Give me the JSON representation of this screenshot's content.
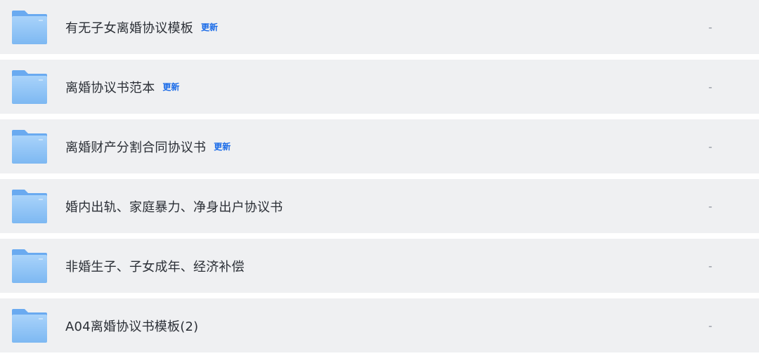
{
  "files": [
    {
      "name": "有无子女离婚协议模板",
      "badge": "更新",
      "meta": "-"
    },
    {
      "name": "离婚协议书范本",
      "badge": "更新",
      "meta": "-"
    },
    {
      "name": "离婚财产分割合同协议书",
      "badge": "更新",
      "meta": "-"
    },
    {
      "name": "婚内出轨、家庭暴力、净身出户协议书",
      "badge": "",
      "meta": "-"
    },
    {
      "name": "非婚生子、子女成年、经济补偿",
      "badge": "",
      "meta": "-"
    },
    {
      "name": "A04离婚协议书模板(2)",
      "badge": "",
      "meta": "-"
    }
  ],
  "icons": {
    "folder": "folder-icon"
  },
  "colors": {
    "row_bg": "#eff0f2",
    "badge": "#1a6be8",
    "folder": "#8fc4f5"
  }
}
